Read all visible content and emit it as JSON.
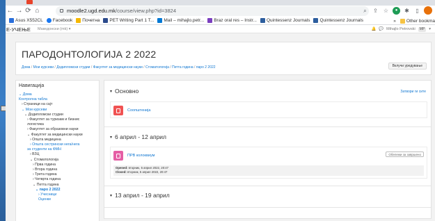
{
  "browser": {
    "url_host": "moodle2.ugd.edu.mk",
    "url_path": "/course/view.php?id=3824",
    "bookmarks": [
      {
        "label": "Asus X552CL",
        "color": "#2a6fdb"
      },
      {
        "label": "Facebook",
        "color": "#1877f2"
      },
      {
        "label": "Почетна",
        "color": "#f5b800"
      },
      {
        "label": "PET Writing Part 1 T...",
        "color": "#2c4a8c"
      },
      {
        "label": "Mail – mihajlo.petr...",
        "color": "#0078d4"
      },
      {
        "label": "Braz oral res – Instr...",
        "color": "#7b3fbf"
      },
      {
        "label": "Quintessenz Journals",
        "color": "#2d5e9e"
      },
      {
        "label": "Quintessenz Journals",
        "color": "#2d5e9e"
      }
    ],
    "bookmarks_overflow": "»",
    "other_bookmarks": "Other bookma"
  },
  "moodle_nav": {
    "brand": "Е-УЧЕЊЕ",
    "language": "Македонски (mk) ▾",
    "user_name": "Mihajlo Petrovski",
    "user_initials": "MP"
  },
  "course": {
    "title": "ПАРОДОНТОЛОГИЈА 2 2022",
    "breadcrumb": [
      "Дома",
      "Мои курсеви",
      "Додипломски студии",
      "Факултет за медицински науки",
      "Стоматологија",
      "Петта година",
      "паро 2 2022"
    ],
    "edit_button": "Вклучи уредување"
  },
  "navigation": {
    "title": "Навигација",
    "items": [
      {
        "text": "⌄ Дома",
        "style": "l",
        "indent": 0
      },
      {
        "text": "Контролна табла",
        "style": "l",
        "indent": 0,
        "icon": "🏠"
      },
      {
        "text": "› Страници на сајт",
        "style": "",
        "indent": 1
      },
      {
        "text": "⌄ Мои курсеви",
        "style": "l",
        "indent": 1
      },
      {
        "text": "⌄ Додипломски студии",
        "style": "",
        "indent": 2
      },
      {
        "text": "› Факултет за туризам и бизнис",
        "style": "",
        "indent": 3
      },
      {
        "text": "логистика",
        "style": "",
        "indent": 3
      },
      {
        "text": "› Факултет за образовни науки",
        "style": "",
        "indent": 3
      },
      {
        "text": "⌄ Факултет за медицински науки",
        "style": "",
        "indent": 3
      },
      {
        "text": "› Општа медицина",
        "style": "",
        "indent": 4
      },
      {
        "text": "› Општа сестрински нега/нега",
        "style": "l",
        "indent": 4
      },
      {
        "text": "за студенти на ФМН",
        "style": "l",
        "indent": 3
      },
      {
        "text": "› ВЗЦ",
        "style": "",
        "indent": 4
      },
      {
        "text": "⌄ Стоматологија",
        "style": "",
        "indent": 4
      },
      {
        "text": "› Прва година",
        "style": "",
        "indent": 5
      },
      {
        "text": "› Втора година",
        "style": "",
        "indent": 5
      },
      {
        "text": "› Трета година",
        "style": "",
        "indent": 5
      },
      {
        "text": "› Четврта година",
        "style": "",
        "indent": 5
      },
      {
        "text": "⌄ Петта година",
        "style": "",
        "indent": 5
      },
      {
        "text": "⌄ паро 2 2022",
        "style": "b",
        "indent": 6
      },
      {
        "text": "› Учесници",
        "style": "l",
        "indent": 7
      },
      {
        "text": "Оценки",
        "style": "l",
        "indent": 7
      }
    ]
  },
  "sections": {
    "main_title": "Основно",
    "collapse_all": "Затвори ги сите",
    "forum_name": "Соопштенија",
    "week1_title": "6 април - 12 април",
    "assign_name": "ПРВ колоквиум",
    "mark_done": "Обележи за завршено",
    "opened_label": "Opened:",
    "opened_value": "вторник, 5 април 2022, 20:47",
    "closed_label": "Closed:",
    "closed_value": "вторник, 5 април 2022, 20:47",
    "week2_title": "13 април - 19 април"
  },
  "colors": {
    "forum_icon": "#f05252",
    "assign_icon": "#e55fa5",
    "link": "#1177d1",
    "tab_accent": "#e8432a"
  }
}
